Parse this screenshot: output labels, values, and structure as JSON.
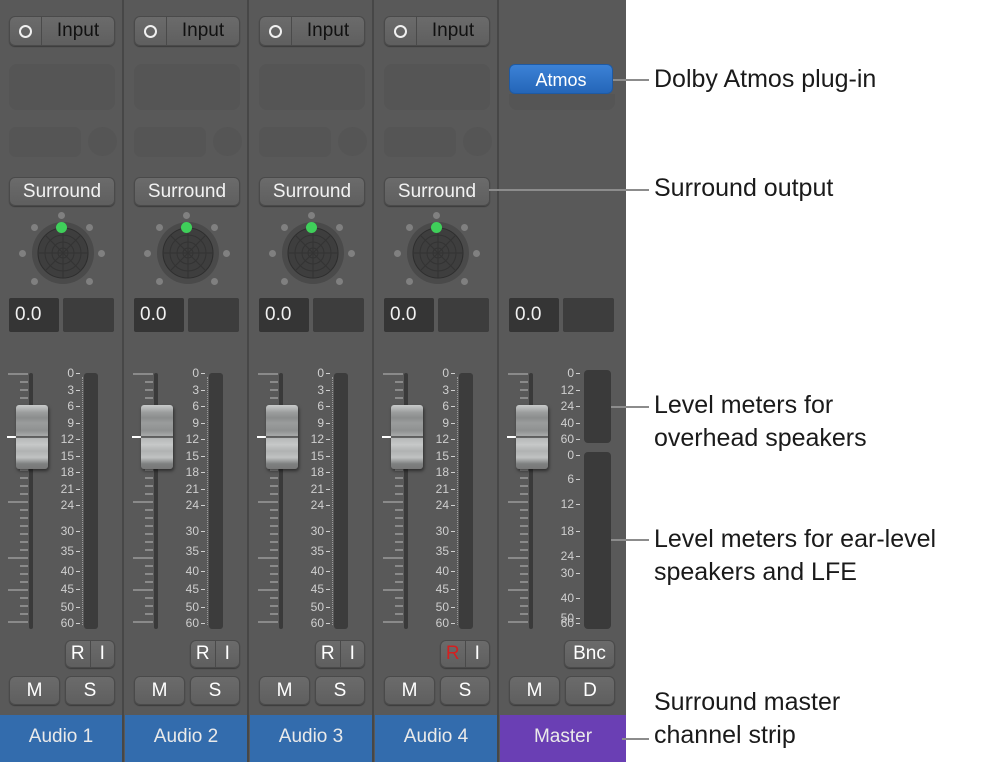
{
  "colors": {
    "strip_bg": "#595959",
    "audio_name_bg": "#336cad",
    "master_name_bg": "#6a3fb4",
    "panner_dot_active": "#3fcf5a",
    "atmos_button": "#2a6fc4",
    "record_active": "#d42020"
  },
  "channels": [
    {
      "name": "Audio 1",
      "input_label": "Input",
      "output_label": "Surround",
      "volume": "0.0",
      "r_label": "R",
      "i_label": "I",
      "m_label": "M",
      "s_label": "S",
      "record_armed": false
    },
    {
      "name": "Audio 2",
      "input_label": "Input",
      "output_label": "Surround",
      "volume": "0.0",
      "r_label": "R",
      "i_label": "I",
      "m_label": "M",
      "s_label": "S",
      "record_armed": false
    },
    {
      "name": "Audio 3",
      "input_label": "Input",
      "output_label": "Surround",
      "volume": "0.0",
      "r_label": "R",
      "i_label": "I",
      "m_label": "M",
      "s_label": "S",
      "record_armed": false
    },
    {
      "name": "Audio 4",
      "input_label": "Input",
      "output_label": "Surround",
      "volume": "0.0",
      "r_label": "R",
      "i_label": "I",
      "m_label": "M",
      "s_label": "S",
      "record_armed": true
    }
  ],
  "channel_scale": [
    "0",
    "3",
    "6",
    "9",
    "12",
    "15",
    "18",
    "21",
    "24",
    "30",
    "35",
    "40",
    "45",
    "50",
    "60"
  ],
  "master": {
    "name": "Master",
    "plugin_label": "Atmos",
    "volume": "0.0",
    "bnc_label": "Bnc",
    "m_label": "M",
    "d_label": "D",
    "overhead_scale": [
      "0",
      "12",
      "24",
      "40",
      "60"
    ],
    "ear_scale": [
      "0",
      "6",
      "12",
      "18",
      "24",
      "30",
      "40",
      "50",
      "60"
    ]
  },
  "callouts": {
    "plugin": "Dolby Atmos plug-in",
    "surround_output": "Surround output",
    "overhead_line1": "Level meters for",
    "overhead_line2": "overhead speakers",
    "ear_line1": "Level meters for ear-level",
    "ear_line2": "speakers and LFE",
    "master_line1": "Surround master",
    "master_line2": "channel strip"
  }
}
